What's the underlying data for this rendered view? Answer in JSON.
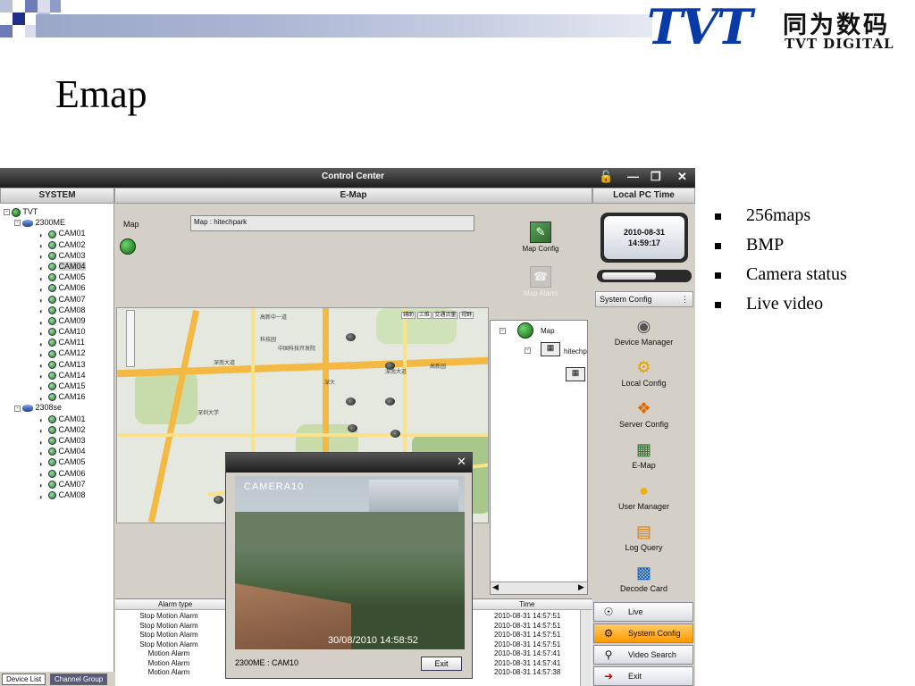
{
  "slide": {
    "title": "Emap",
    "logo_text": "TVT",
    "logo_chinese": "同为数码",
    "logo_sub": "TVT DIGITAL",
    "bullets": [
      "256maps",
      "BMP",
      "Camera status",
      "Live video"
    ]
  },
  "app": {
    "title": "Control Center",
    "colors": {
      "accent": "#ff9900",
      "titlebar": "#1d1d1d"
    },
    "left_panel": {
      "header": "SYSTEM",
      "root": "TVT",
      "devices": [
        {
          "name": "2300ME",
          "cams": [
            "CAM01",
            "CAM02",
            "CAM03",
            "CAM04",
            "CAM05",
            "CAM06",
            "CAM07",
            "CAM08",
            "CAM09",
            "CAM10",
            "CAM11",
            "CAM12",
            "CAM13",
            "CAM14",
            "CAM15",
            "CAM16"
          ]
        },
        {
          "name": "2308se",
          "cams": [
            "CAM01",
            "CAM02",
            "CAM03",
            "CAM04",
            "CAM05",
            "CAM06",
            "CAM07",
            "CAM08"
          ]
        }
      ],
      "tabs": [
        "Device List",
        "Channel Group"
      ]
    },
    "emap": {
      "header": "E-Map",
      "map_label": "Map",
      "map_field_value": "Map : hitechpark",
      "map_config_label": "Map Config",
      "map_alarm_label": "Map Alarm",
      "map_tree_root": "Map",
      "map_tree_child": "hitechp",
      "map_toolbar": [
        "辅助",
        "三维",
        "交通流量",
        "视野"
      ],
      "map_labels": [
        "深南大道",
        "深大",
        "深圳大学",
        "科技园",
        "高新园",
        "高新中一道",
        "中国科技开发院",
        "深南大道"
      ]
    },
    "alarms": {
      "col_type": "Alarm type",
      "col_time": "Time",
      "rows": [
        {
          "type": "Stop Motion Alarm",
          "time": "2010-08-31 14:57:51"
        },
        {
          "type": "Stop Motion Alarm",
          "time": "2010-08-31 14:57:51"
        },
        {
          "type": "Stop Motion Alarm",
          "time": "2010-08-31 14:57:51"
        },
        {
          "type": "Stop Motion Alarm",
          "time": "2010-08-31 14:57:51"
        },
        {
          "type": "Motion Alarm",
          "time": "2010-08-31 14:57:41"
        },
        {
          "type": "Motion Alarm",
          "time": "2010-08-31 14:57:41"
        },
        {
          "type": "Motion Alarm",
          "time": "2010-08-31 14:57:38"
        }
      ]
    },
    "video_popup": {
      "overlay_camera": "CAMERA10",
      "overlay_timestamp": "30/08/2010 14:58:52",
      "caption": "2300ME : CAM10",
      "exit_label": "Exit"
    },
    "right_panel": {
      "header": "Local PC Time",
      "date": "2010-08-31",
      "time": "14:59:17",
      "system_config_title": "System Config",
      "menu": [
        "Device Manager",
        "Local Config",
        "Server Config",
        "E-Map",
        "User Manager",
        "Log Query",
        "Decode Card"
      ],
      "nav": [
        "Live",
        "System Config",
        "Video Search",
        "Exit"
      ]
    }
  }
}
